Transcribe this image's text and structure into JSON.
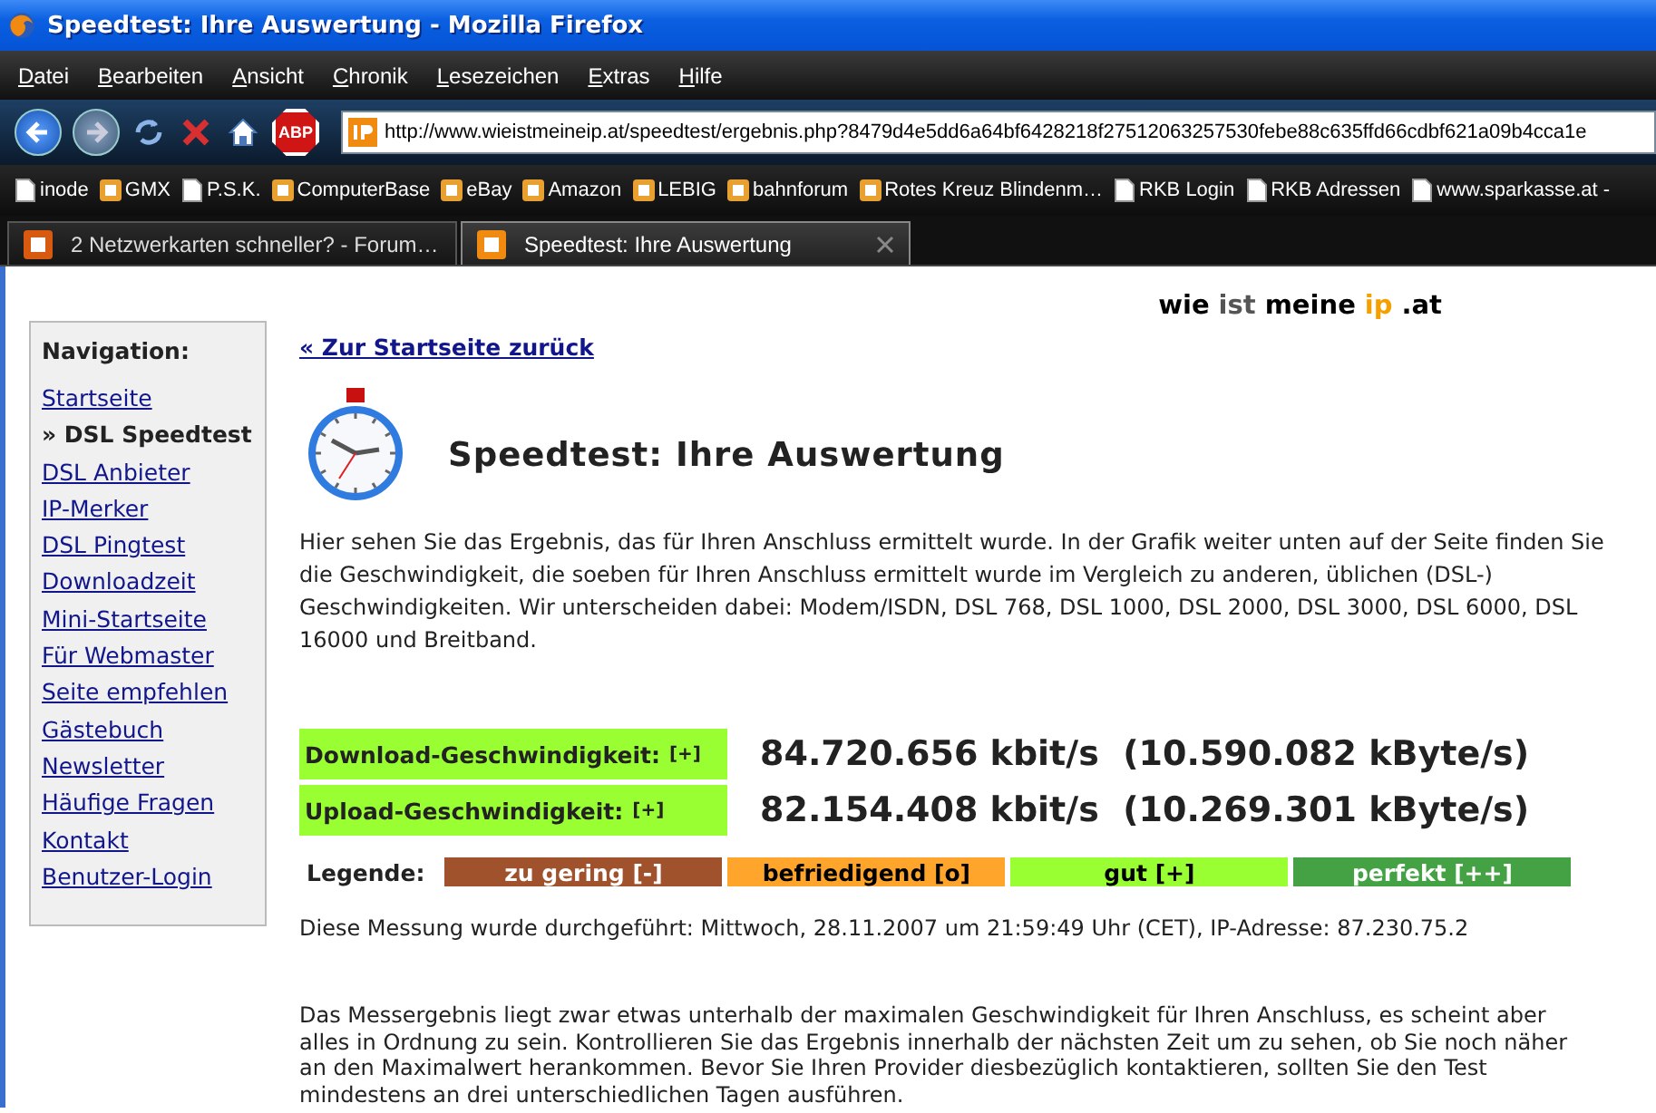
{
  "window": {
    "title": "Speedtest: Ihre Auswertung - Mozilla Firefox"
  },
  "menu": [
    "Datei",
    "Bearbeiten",
    "Ansicht",
    "Chronik",
    "Lesezeichen",
    "Extras",
    "Hilfe"
  ],
  "toolbar": {
    "adblock_label": "ABP",
    "url": "http://www.wieistmeineip.at/speedtest/ergebnis.php?8479d4e5dd6a64bf6428218f27512063257530febe88c635ffd66cdbf621a09b4cca1e"
  },
  "bookmarks": [
    {
      "label": "inode",
      "kind": "page"
    },
    {
      "label": "GMX",
      "kind": "site"
    },
    {
      "label": "P.S.K.",
      "kind": "page"
    },
    {
      "label": "ComputerBase",
      "kind": "site"
    },
    {
      "label": "eBay",
      "kind": "site"
    },
    {
      "label": "Amazon",
      "kind": "site"
    },
    {
      "label": "LEBIG",
      "kind": "site"
    },
    {
      "label": "bahnforum",
      "kind": "site"
    },
    {
      "label": "Rotes Kreuz Blindenm…",
      "kind": "site"
    },
    {
      "label": "RKB Login",
      "kind": "page"
    },
    {
      "label": "RKB Adressen",
      "kind": "page"
    },
    {
      "label": "www.sparkasse.at -",
      "kind": "page"
    }
  ],
  "tabs": [
    {
      "label": "2 Netzwerkarten schneller? - Forum…",
      "selected": false
    },
    {
      "label": "Speedtest: Ihre Auswertung",
      "selected": true
    }
  ],
  "logo": [
    {
      "text": "wie",
      "color": "#000000"
    },
    {
      "text": "ist",
      "color": "#555555"
    },
    {
      "text": "meine",
      "color": "#000000"
    },
    {
      "text": "ip",
      "color": "#f5a000"
    },
    {
      "text": ".at",
      "color": "#000000"
    }
  ],
  "sidebar": {
    "heading": "Navigation:",
    "items": [
      {
        "label": "Startseite",
        "selected": false
      },
      {
        "label": "» DSL Speedtest",
        "selected": true
      },
      {
        "label": "DSL Anbieter",
        "selected": false
      },
      {
        "label": "IP-Merker",
        "selected": false
      },
      {
        "label": "DSL Pingtest",
        "selected": false
      },
      {
        "label": "Downloadzeit",
        "selected": false
      },
      {
        "label": "Mini-Startseite",
        "selected": false
      },
      {
        "label": "Für Webmaster",
        "selected": false
      },
      {
        "label": "Seite empfehlen",
        "selected": false
      },
      {
        "label": "Gästebuch",
        "selected": false
      },
      {
        "label": "Newsletter",
        "selected": false
      },
      {
        "label": "Häufige Fragen",
        "selected": false
      },
      {
        "label": "Kontakt",
        "selected": false
      },
      {
        "label": "Benutzer-Login",
        "selected": false
      }
    ]
  },
  "back_link": "« Zur Startseite zurück",
  "heading": "Speedtest: Ihre Auswertung",
  "intro": "Hier sehen Sie das Ergebnis, das für Ihren Anschluss ermittelt wurde. In der Grafik weiter unten auf der Seite finden Sie die Geschwindigkeit, die soeben für Ihren Anschluss ermittelt wurde im Vergleich zu anderen, üblichen (DSL-) Geschwindigkeiten. Wir unterscheiden dabei: Modem/ISDN, DSL 768, DSL 1000, DSL 2000, DSL 3000, DSL 6000, DSL 16000 und Breitband.",
  "results": [
    {
      "label": "Download-Geschwindigkeit:",
      "rating": "[+]",
      "color": "#99ff33",
      "value": "84.720.656 kbit/s  (10.590.082 kByte/s)"
    },
    {
      "label": "Upload-Geschwindigkeit:",
      "rating": "[+]",
      "color": "#99ff33",
      "value": "82.154.408 kbit/s  (10.269.301 kByte/s)"
    }
  ],
  "legend": {
    "label": "Legende:",
    "items": [
      {
        "label": "zu gering [-]",
        "color": "#a0522d"
      },
      {
        "label": "befriedigend [o]",
        "color": "#ffa52c"
      },
      {
        "label": "gut [+]",
        "color": "#99ff33"
      },
      {
        "label": "perfekt [++]",
        "color": "#44a244"
      }
    ]
  },
  "measurement": "Diese Messung wurde durchgeführt: Mittwoch, 28.11.2007 um 21:59:49 Uhr (CET), IP-Adresse: 87.230.75.2",
  "verdict": "Das Messergebnis liegt zwar etwas unterhalb der maximalen Geschwindigkeit für Ihren Anschluss, es scheint aber alles in Ordnung zu sein. Kontrollieren Sie das Ergebnis innerhalb der nächsten Zeit um zu sehen, ob Sie noch näher an den Maximalwert herankommen. Bevor Sie Ihren Provider diesbezüglich kontaktieren, sollten Sie den Test mindestens an drei unterschiedlichen Tagen ausführen."
}
